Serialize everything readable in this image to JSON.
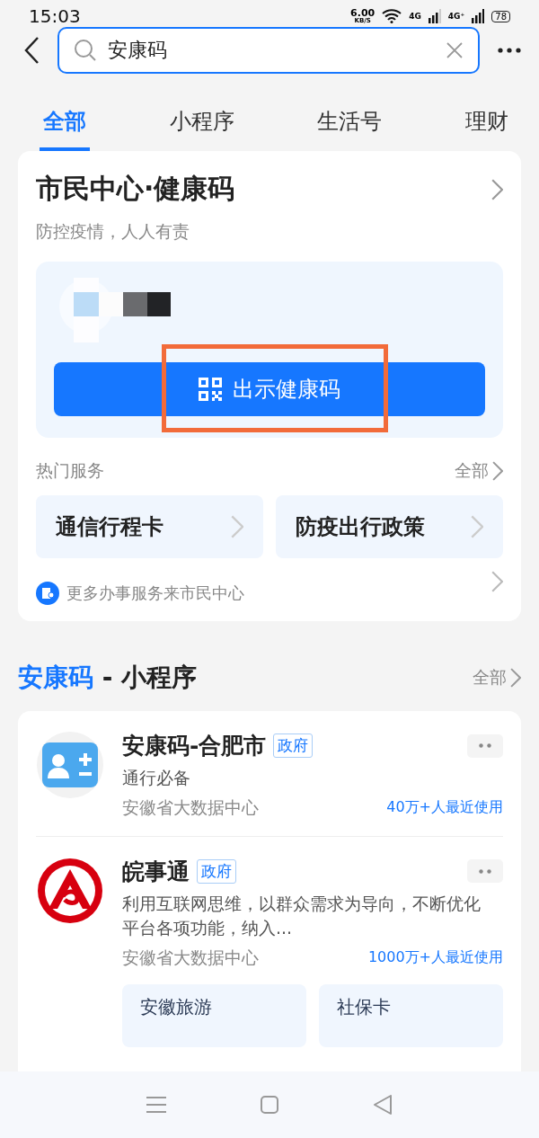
{
  "status_bar": {
    "time": "15:03",
    "speed": "6.00",
    "speed_unit": "KB/S",
    "network_1": "4G",
    "network_2": "4G⁺",
    "battery": "78"
  },
  "search": {
    "value": "安康码"
  },
  "tabs": [
    {
      "label": "全部",
      "selected": true
    },
    {
      "label": "小程序",
      "selected": false
    },
    {
      "label": "生活号",
      "selected": false
    },
    {
      "label": "理财",
      "selected": false
    }
  ],
  "citizen_card": {
    "title": "市民中心·健康码",
    "subtitle": "防控疫情，人人有责",
    "health_code": {
      "kind": "picture",
      "button": "出示健康码",
      "highlighted": true
    },
    "hot_services": {
      "title": "热门服务",
      "more": "全部",
      "items": [
        "通信行程卡",
        "防疫出行政策"
      ]
    },
    "footer": "更多办事服务来市民中心"
  },
  "mini_programs": {
    "keyword": "安康码",
    "title_suffix": " - 小程序",
    "more": "全部",
    "items": [
      {
        "name": "安康码-合肥市",
        "kind": "contact",
        "tag": "政府",
        "description": "通行必备",
        "provider": "安徽省大数据中心",
        "usage": "40万+人最近使用"
      },
      {
        "name": "皖事通",
        "kind": "emblem",
        "tag": "政府",
        "description": "利用互联网思维，以群众需求为导向，不断优化平台各项功能，纳入...",
        "provider": "安徽省大数据中心",
        "usage": "1000万+人最近使用",
        "services": [
          "安徽旅游",
          "社保卡"
        ]
      }
    ]
  }
}
